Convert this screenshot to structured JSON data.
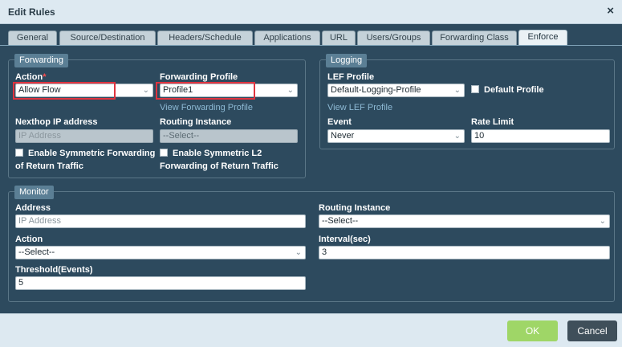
{
  "dialog": {
    "title": "Edit Rules",
    "close_symbol": "×"
  },
  "tabs": [
    {
      "label": "General"
    },
    {
      "label": "Source/Destination"
    },
    {
      "label": "Headers/Schedule"
    },
    {
      "label": "Applications"
    },
    {
      "label": "URL"
    },
    {
      "label": "Users/Groups"
    },
    {
      "label": "Forwarding Class"
    },
    {
      "label": "Enforce"
    }
  ],
  "forwarding": {
    "legend": "Forwarding",
    "action_label": "Action",
    "required_mark": "*",
    "action_value": "Allow Flow",
    "profile_label": "Forwarding Profile",
    "profile_value": "Profile1",
    "view_profile_link": "View Forwarding Profile",
    "nexthop_label": "Nexthop IP address",
    "nexthop_placeholder": "IP Address",
    "routing_instance_label": "Routing Instance",
    "routing_instance_value": "--Select--",
    "sym_fwd_line1": "Enable Symmetric Forwarding",
    "sym_fwd_line2": "of Return Traffic",
    "sym_l2_line1": "Enable Symmetric L2",
    "sym_l2_line2": "Forwarding of Return Traffic"
  },
  "logging": {
    "legend": "Logging",
    "lef_profile_label": "LEF Profile",
    "lef_profile_value": "Default-Logging-Profile",
    "default_profile_label": "Default Profile",
    "view_lef_link": "View LEF Profile",
    "event_label": "Event",
    "event_value": "Never",
    "rate_limit_label": "Rate Limit",
    "rate_limit_value": "10"
  },
  "monitor": {
    "legend": "Monitor",
    "address_label": "Address",
    "address_placeholder": "IP Address",
    "routing_instance_label": "Routing Instance",
    "routing_instance_value": "--Select--",
    "action_label": "Action",
    "action_value": "--Select--",
    "interval_label": "Interval(sec)",
    "interval_value": "3",
    "threshold_label": "Threshold(Events)",
    "threshold_value": "5"
  },
  "footer": {
    "ok_label": "OK",
    "cancel_label": "Cancel"
  },
  "colors": {
    "ok": "#9fd667",
    "cancel": "#3f4f5a",
    "highlight": "#e0343f",
    "body": "#2d4a5e"
  }
}
